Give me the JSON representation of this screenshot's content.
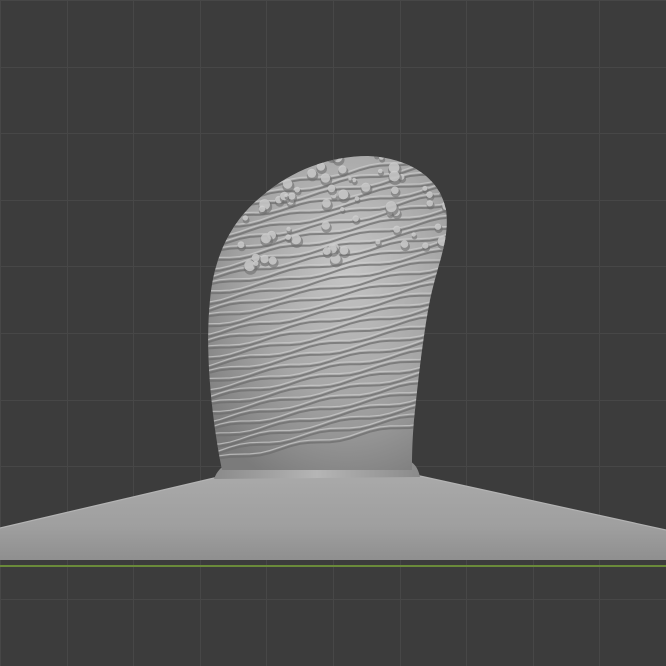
{
  "viewport": {
    "background_color": "#3c3c3c",
    "grid_line_color": "#474747",
    "horizon_axis_color": "#6a8a3a",
    "mesh_base_color": "#a6a6a6",
    "mesh_shadow_color": "#6e6e6e",
    "mesh_highlight_color": "#cfcfcf",
    "mesh_object": "sculpted-bulb-on-base-icon"
  }
}
